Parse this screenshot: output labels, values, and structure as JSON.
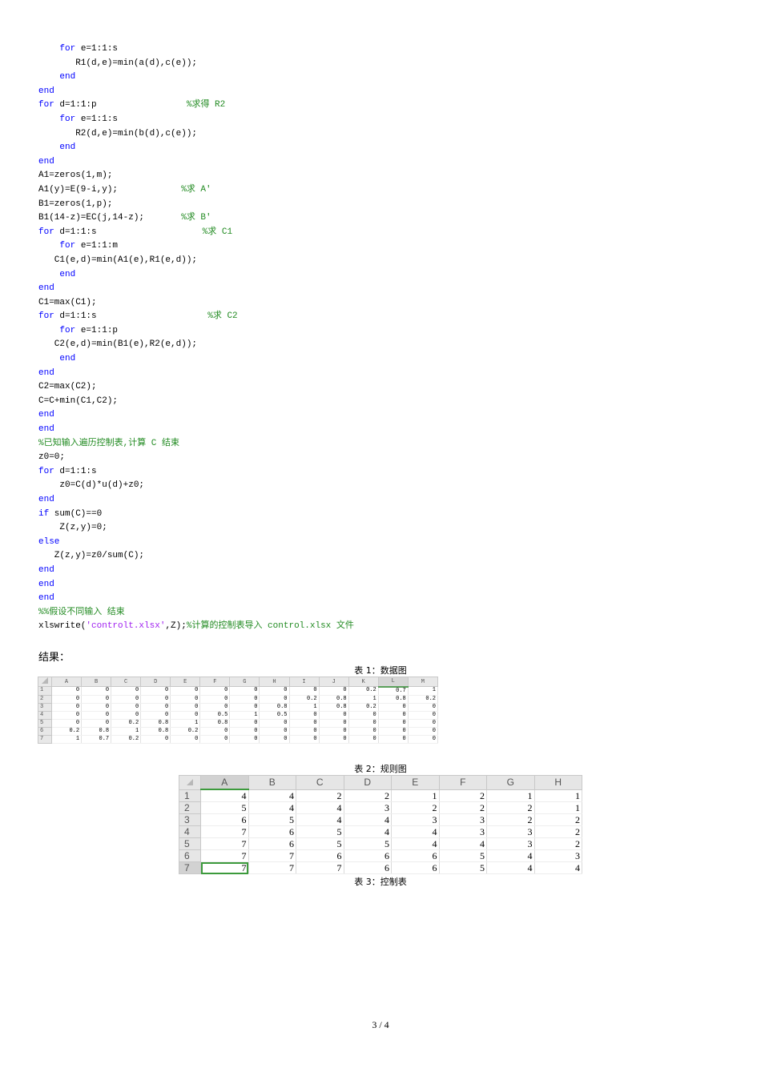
{
  "code_lines": [
    [
      {
        "t": "    "
      },
      {
        "t": "for",
        "c": "kw"
      },
      {
        "t": " e=1:1:s"
      }
    ],
    [
      {
        "t": "       R1(d,e)=min(a(d),c(e));"
      }
    ],
    [
      {
        "t": "    "
      },
      {
        "t": "end",
        "c": "kw"
      }
    ],
    [
      {
        "t": "end",
        "c": "kw"
      }
    ],
    [
      {
        "t": "for",
        "c": "kw"
      },
      {
        "t": " d=1:1:p                 "
      },
      {
        "t": "%求得 R2",
        "c": "cm"
      }
    ],
    [
      {
        "t": "    "
      },
      {
        "t": "for",
        "c": "kw"
      },
      {
        "t": " e=1:1:s"
      }
    ],
    [
      {
        "t": "       R2(d,e)=min(b(d),c(e));"
      }
    ],
    [
      {
        "t": "    "
      },
      {
        "t": "end",
        "c": "kw"
      }
    ],
    [
      {
        "t": "end",
        "c": "kw"
      }
    ],
    [
      {
        "t": "A1=zeros(1,m);"
      }
    ],
    [
      {
        "t": "A1(y)=E(9-i,y);            "
      },
      {
        "t": "%求 A'",
        "c": "cm"
      }
    ],
    [
      {
        "t": "B1=zeros(1,p);"
      }
    ],
    [
      {
        "t": "B1(14-z)=EC(j,14-z);       "
      },
      {
        "t": "%求 B'",
        "c": "cm"
      }
    ],
    [
      {
        "t": "for",
        "c": "kw"
      },
      {
        "t": " d=1:1:s                    "
      },
      {
        "t": "%求 C1",
        "c": "cm"
      }
    ],
    [
      {
        "t": "    "
      },
      {
        "t": "for",
        "c": "kw"
      },
      {
        "t": " e=1:1:m"
      }
    ],
    [
      {
        "t": "   C1(e,d)=min(A1(e),R1(e,d));"
      }
    ],
    [
      {
        "t": "    "
      },
      {
        "t": "end",
        "c": "kw"
      }
    ],
    [
      {
        "t": "end",
        "c": "kw"
      }
    ],
    [
      {
        "t": "C1=max(C1);"
      }
    ],
    [
      {
        "t": "for",
        "c": "kw"
      },
      {
        "t": " d=1:1:s                     "
      },
      {
        "t": "%求 C2",
        "c": "cm"
      }
    ],
    [
      {
        "t": "    "
      },
      {
        "t": "for",
        "c": "kw"
      },
      {
        "t": " e=1:1:p"
      }
    ],
    [
      {
        "t": "   C2(e,d)=min(B1(e),R2(e,d));"
      }
    ],
    [
      {
        "t": "    "
      },
      {
        "t": "end",
        "c": "kw"
      }
    ],
    [
      {
        "t": "end",
        "c": "kw"
      }
    ],
    [
      {
        "t": "C2=max(C2);"
      }
    ],
    [
      {
        "t": "C=C+min(C1,C2);"
      }
    ],
    [
      {
        "t": "end",
        "c": "kw"
      }
    ],
    [
      {
        "t": "end",
        "c": "kw"
      }
    ],
    [
      {
        "t": "%已知输入遍历控制表,计算 C 结束",
        "c": "cm"
      }
    ],
    [
      {
        "t": "z0=0;"
      }
    ],
    [
      {
        "t": "for",
        "c": "kw"
      },
      {
        "t": " d=1:1:s"
      }
    ],
    [
      {
        "t": "    z0=C(d)*u(d)+z0;"
      }
    ],
    [
      {
        "t": "end",
        "c": "kw"
      }
    ],
    [
      {
        "t": "if",
        "c": "kw"
      },
      {
        "t": " sum(C)==0"
      }
    ],
    [
      {
        "t": "    Z(z,y)=0;"
      }
    ],
    [
      {
        "t": "else",
        "c": "kw"
      }
    ],
    [
      {
        "t": "   Z(z,y)=z0/sum(C);"
      }
    ],
    [
      {
        "t": "end",
        "c": "kw"
      }
    ],
    [
      {
        "t": "end",
        "c": "kw"
      }
    ],
    [
      {
        "t": "end",
        "c": "kw"
      }
    ],
    [
      {
        "t": "%%假设不同输入 结束",
        "c": "cm"
      }
    ],
    [
      {
        "t": "xlswrite("
      },
      {
        "t": "'controlt.xlsx'",
        "c": "str"
      },
      {
        "t": ",Z);"
      },
      {
        "t": "%计算的控制表导入 control.xlsx 文件",
        "c": "cm"
      }
    ]
  ],
  "result_label": "结果：",
  "caption1": "表 1：数据图",
  "caption2": "表 2：规则图",
  "caption3": "表 3：控制表",
  "sheet1": {
    "columns": [
      "A",
      "B",
      "C",
      "D",
      "E",
      "F",
      "G",
      "H",
      "I",
      "J",
      "K",
      "L",
      "M"
    ],
    "selected_column": "L",
    "rows": [
      [
        "1",
        "0",
        "0",
        "0",
        "0",
        "0",
        "0",
        "0",
        "0",
        "0",
        "0",
        "0.2",
        "0.7",
        "1"
      ],
      [
        "2",
        "0",
        "0",
        "0",
        "0",
        "0",
        "0",
        "0",
        "0",
        "0.2",
        "0.8",
        "1",
        "0.8",
        "0.2"
      ],
      [
        "3",
        "0",
        "0",
        "0",
        "0",
        "0",
        "0",
        "0",
        "0.8",
        "1",
        "0.8",
        "0.2",
        "0",
        "0"
      ],
      [
        "4",
        "0",
        "0",
        "0",
        "0",
        "0",
        "0.5",
        "1",
        "0.5",
        "0",
        "0",
        "0",
        "0",
        "0"
      ],
      [
        "5",
        "0",
        "0",
        "0.2",
        "0.8",
        "1",
        "0.8",
        "0",
        "0",
        "0",
        "0",
        "0",
        "0",
        "0"
      ],
      [
        "6",
        "0.2",
        "0.8",
        "1",
        "0.8",
        "0.2",
        "0",
        "0",
        "0",
        "0",
        "0",
        "0",
        "0",
        "0"
      ],
      [
        "7",
        "1",
        "0.7",
        "0.2",
        "0",
        "0",
        "0",
        "0",
        "0",
        "0",
        "0",
        "0",
        "0",
        "0"
      ]
    ]
  },
  "sheet2": {
    "columns": [
      "A",
      "B",
      "C",
      "D",
      "E",
      "F",
      "G",
      "H"
    ],
    "selected_column": "A",
    "selected_row": "7",
    "rows": [
      [
        "1",
        "4",
        "4",
        "2",
        "2",
        "1",
        "2",
        "1",
        "1"
      ],
      [
        "2",
        "5",
        "4",
        "4",
        "3",
        "2",
        "2",
        "2",
        "1"
      ],
      [
        "3",
        "6",
        "5",
        "4",
        "4",
        "3",
        "3",
        "2",
        "2"
      ],
      [
        "4",
        "7",
        "6",
        "5",
        "4",
        "4",
        "3",
        "3",
        "2"
      ],
      [
        "5",
        "7",
        "6",
        "5",
        "5",
        "4",
        "4",
        "3",
        "2"
      ],
      [
        "6",
        "7",
        "7",
        "6",
        "6",
        "6",
        "5",
        "4",
        "3"
      ],
      [
        "7",
        "7",
        "7",
        "7",
        "6",
        "6",
        "5",
        "4",
        "4"
      ]
    ]
  },
  "page_number": "3 / 4"
}
